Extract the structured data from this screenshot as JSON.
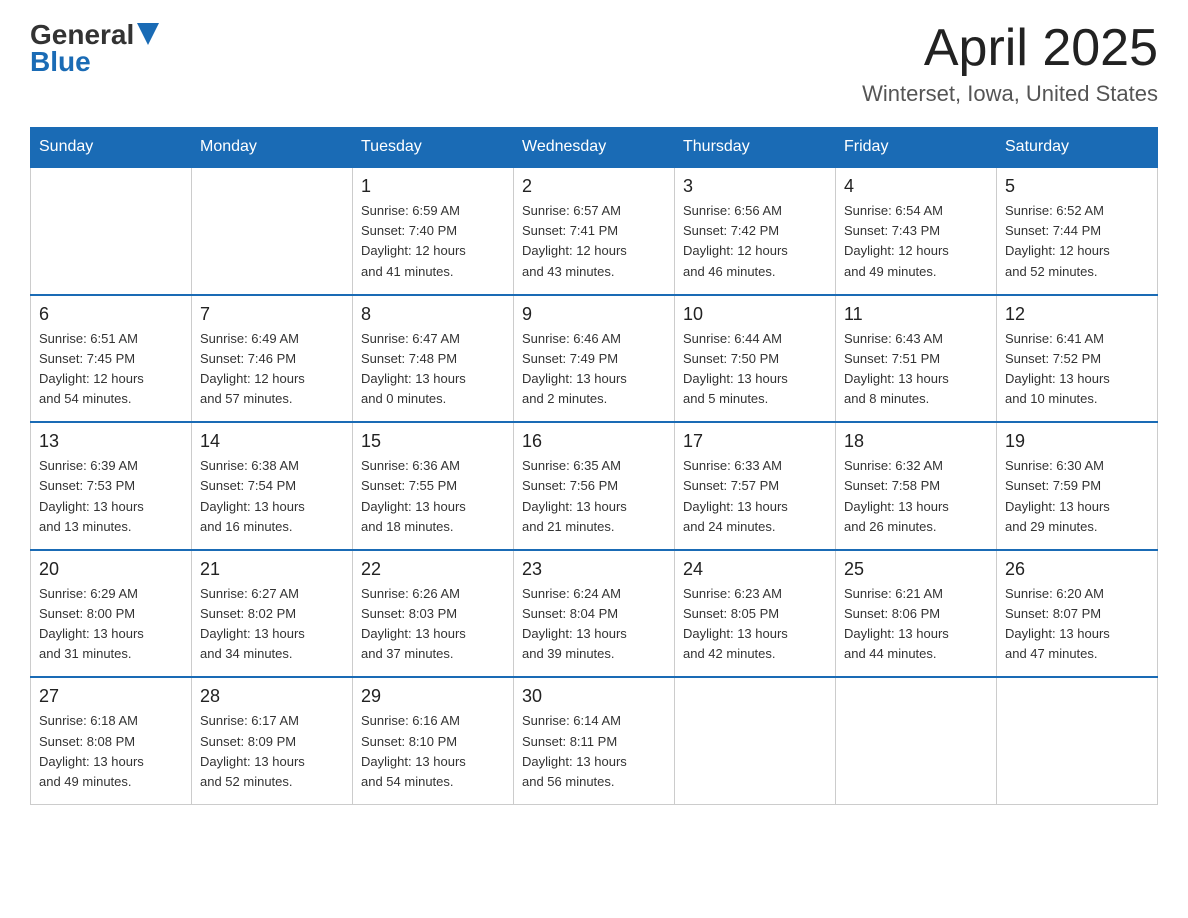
{
  "header": {
    "logo_general": "General",
    "logo_blue": "Blue",
    "title": "April 2025",
    "subtitle": "Winterset, Iowa, United States"
  },
  "days_of_week": [
    "Sunday",
    "Monday",
    "Tuesday",
    "Wednesday",
    "Thursday",
    "Friday",
    "Saturday"
  ],
  "weeks": [
    [
      {
        "day": "",
        "info": ""
      },
      {
        "day": "",
        "info": ""
      },
      {
        "day": "1",
        "info": "Sunrise: 6:59 AM\nSunset: 7:40 PM\nDaylight: 12 hours\nand 41 minutes."
      },
      {
        "day": "2",
        "info": "Sunrise: 6:57 AM\nSunset: 7:41 PM\nDaylight: 12 hours\nand 43 minutes."
      },
      {
        "day": "3",
        "info": "Sunrise: 6:56 AM\nSunset: 7:42 PM\nDaylight: 12 hours\nand 46 minutes."
      },
      {
        "day": "4",
        "info": "Sunrise: 6:54 AM\nSunset: 7:43 PM\nDaylight: 12 hours\nand 49 minutes."
      },
      {
        "day": "5",
        "info": "Sunrise: 6:52 AM\nSunset: 7:44 PM\nDaylight: 12 hours\nand 52 minutes."
      }
    ],
    [
      {
        "day": "6",
        "info": "Sunrise: 6:51 AM\nSunset: 7:45 PM\nDaylight: 12 hours\nand 54 minutes."
      },
      {
        "day": "7",
        "info": "Sunrise: 6:49 AM\nSunset: 7:46 PM\nDaylight: 12 hours\nand 57 minutes."
      },
      {
        "day": "8",
        "info": "Sunrise: 6:47 AM\nSunset: 7:48 PM\nDaylight: 13 hours\nand 0 minutes."
      },
      {
        "day": "9",
        "info": "Sunrise: 6:46 AM\nSunset: 7:49 PM\nDaylight: 13 hours\nand 2 minutes."
      },
      {
        "day": "10",
        "info": "Sunrise: 6:44 AM\nSunset: 7:50 PM\nDaylight: 13 hours\nand 5 minutes."
      },
      {
        "day": "11",
        "info": "Sunrise: 6:43 AM\nSunset: 7:51 PM\nDaylight: 13 hours\nand 8 minutes."
      },
      {
        "day": "12",
        "info": "Sunrise: 6:41 AM\nSunset: 7:52 PM\nDaylight: 13 hours\nand 10 minutes."
      }
    ],
    [
      {
        "day": "13",
        "info": "Sunrise: 6:39 AM\nSunset: 7:53 PM\nDaylight: 13 hours\nand 13 minutes."
      },
      {
        "day": "14",
        "info": "Sunrise: 6:38 AM\nSunset: 7:54 PM\nDaylight: 13 hours\nand 16 minutes."
      },
      {
        "day": "15",
        "info": "Sunrise: 6:36 AM\nSunset: 7:55 PM\nDaylight: 13 hours\nand 18 minutes."
      },
      {
        "day": "16",
        "info": "Sunrise: 6:35 AM\nSunset: 7:56 PM\nDaylight: 13 hours\nand 21 minutes."
      },
      {
        "day": "17",
        "info": "Sunrise: 6:33 AM\nSunset: 7:57 PM\nDaylight: 13 hours\nand 24 minutes."
      },
      {
        "day": "18",
        "info": "Sunrise: 6:32 AM\nSunset: 7:58 PM\nDaylight: 13 hours\nand 26 minutes."
      },
      {
        "day": "19",
        "info": "Sunrise: 6:30 AM\nSunset: 7:59 PM\nDaylight: 13 hours\nand 29 minutes."
      }
    ],
    [
      {
        "day": "20",
        "info": "Sunrise: 6:29 AM\nSunset: 8:00 PM\nDaylight: 13 hours\nand 31 minutes."
      },
      {
        "day": "21",
        "info": "Sunrise: 6:27 AM\nSunset: 8:02 PM\nDaylight: 13 hours\nand 34 minutes."
      },
      {
        "day": "22",
        "info": "Sunrise: 6:26 AM\nSunset: 8:03 PM\nDaylight: 13 hours\nand 37 minutes."
      },
      {
        "day": "23",
        "info": "Sunrise: 6:24 AM\nSunset: 8:04 PM\nDaylight: 13 hours\nand 39 minutes."
      },
      {
        "day": "24",
        "info": "Sunrise: 6:23 AM\nSunset: 8:05 PM\nDaylight: 13 hours\nand 42 minutes."
      },
      {
        "day": "25",
        "info": "Sunrise: 6:21 AM\nSunset: 8:06 PM\nDaylight: 13 hours\nand 44 minutes."
      },
      {
        "day": "26",
        "info": "Sunrise: 6:20 AM\nSunset: 8:07 PM\nDaylight: 13 hours\nand 47 minutes."
      }
    ],
    [
      {
        "day": "27",
        "info": "Sunrise: 6:18 AM\nSunset: 8:08 PM\nDaylight: 13 hours\nand 49 minutes."
      },
      {
        "day": "28",
        "info": "Sunrise: 6:17 AM\nSunset: 8:09 PM\nDaylight: 13 hours\nand 52 minutes."
      },
      {
        "day": "29",
        "info": "Sunrise: 6:16 AM\nSunset: 8:10 PM\nDaylight: 13 hours\nand 54 minutes."
      },
      {
        "day": "30",
        "info": "Sunrise: 6:14 AM\nSunset: 8:11 PM\nDaylight: 13 hours\nand 56 minutes."
      },
      {
        "day": "",
        "info": ""
      },
      {
        "day": "",
        "info": ""
      },
      {
        "day": "",
        "info": ""
      }
    ]
  ]
}
